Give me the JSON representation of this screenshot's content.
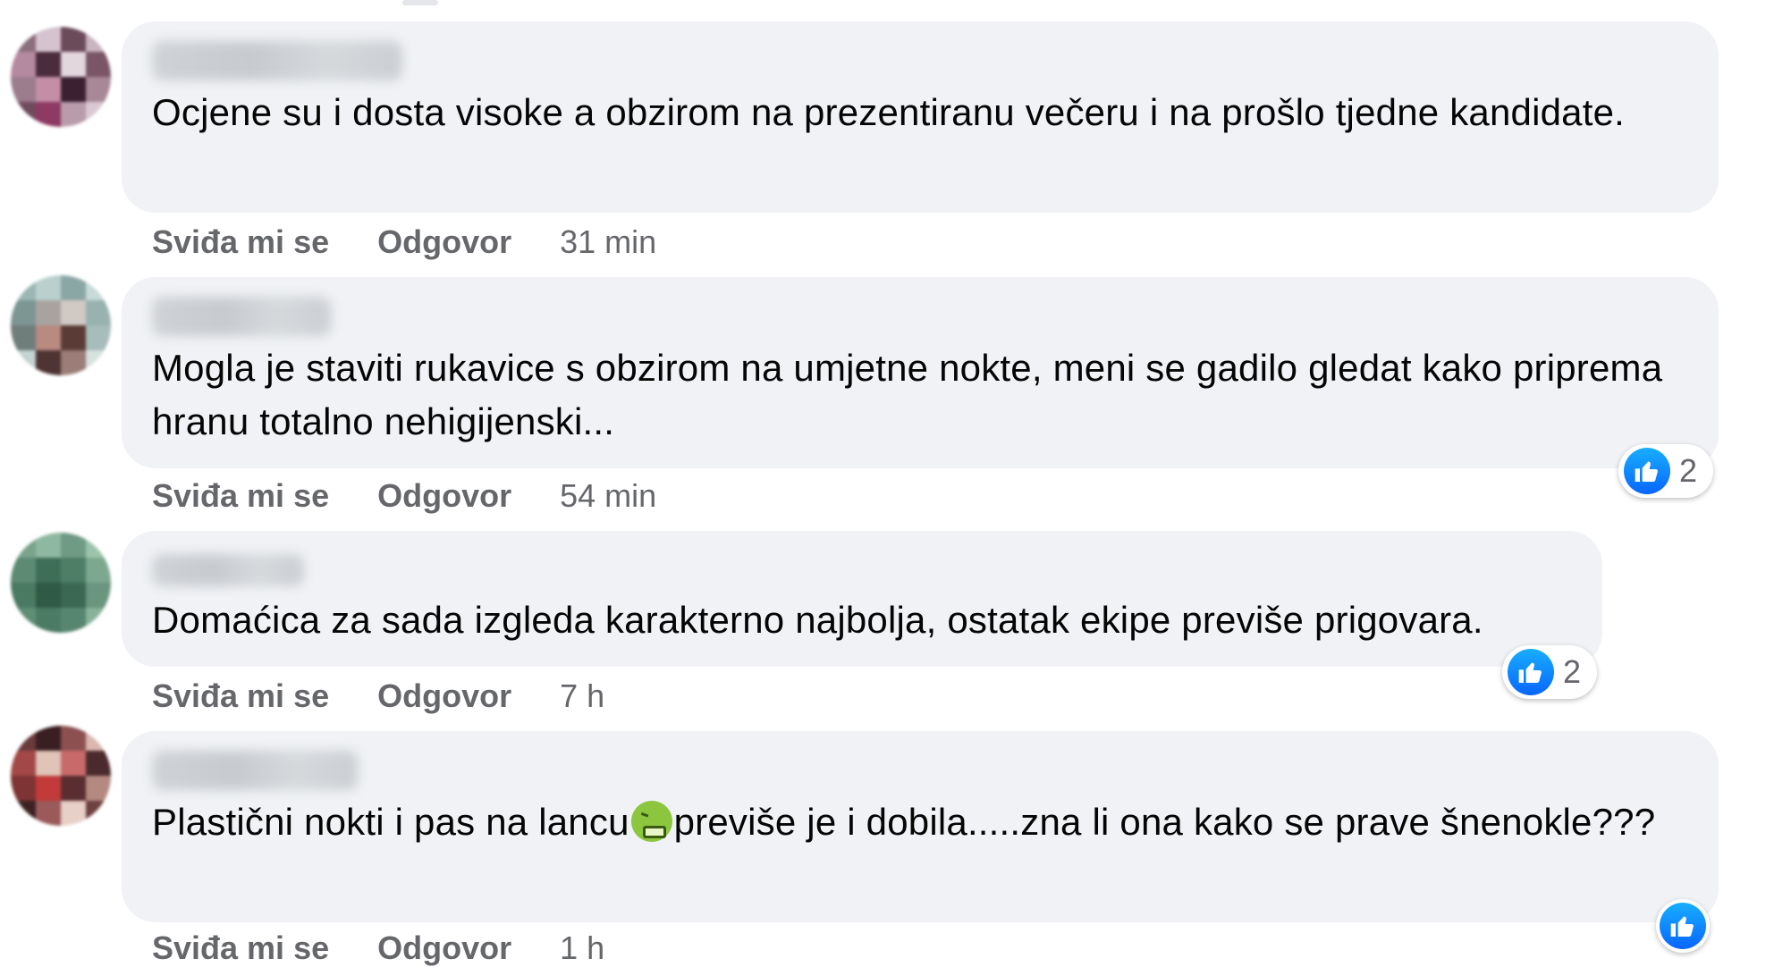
{
  "actions": {
    "like_label": "Sviđa mi se",
    "reply_label": "Odgovor"
  },
  "comments": [
    {
      "text": "Ocjene su i dosta visoke a obzirom na prezentiranu večeru i na prošlo tjedne kandidate.",
      "time": "31 min",
      "reactions": null
    },
    {
      "text": "Mogla je staviti rukavice s obzirom na umjetne nokte, meni se gadilo gledat kako priprema hranu totalno nehigijenski...",
      "time": "54 min",
      "reactions": {
        "icon": "like-icon",
        "count": "2"
      }
    },
    {
      "text": "Domaćica za sada izgleda karakterno najbolja, ostatak ekipe previše prigovara.",
      "time": "7 h",
      "reactions": {
        "icon": "like-icon",
        "count": "2"
      }
    },
    {
      "text_before_emoji": "Plastični nokti i pas na lancu",
      "emoji": "nauseated-face-emoji",
      "text_after_emoji": "previše je i dobila.....zna li ona kako se prave šnenokle???",
      "time": "1 h",
      "reactions": {
        "icon": "like-icon",
        "count": ""
      }
    }
  ],
  "colors": {
    "bubble": "#f0f2f5",
    "action_text": "#65676b",
    "like_blue": "#0866ff"
  }
}
